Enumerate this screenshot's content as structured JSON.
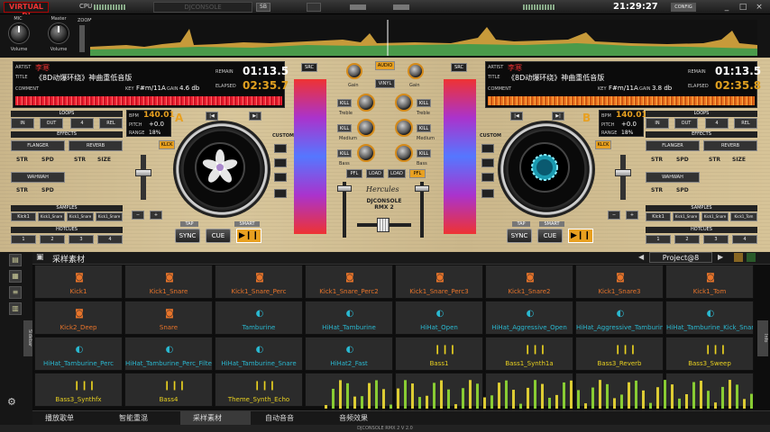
{
  "topbar": {
    "logo": "VIRTUAL DJ",
    "cpu_label": "CPU",
    "skin_name": "DJCONSOLE",
    "sb_label": "SB",
    "clock": "21:29:27",
    "config_label": "CONFIG",
    "minimize": "_",
    "maximize": "□",
    "close": "×"
  },
  "master": {
    "mic_label": "MIC",
    "master_label": "Master",
    "volume_label": "Volume",
    "zoom_label": "ZOOM"
  },
  "deck_a": {
    "artist_label": "ARTIST",
    "artist": "李寒",
    "title_label": "TITLE",
    "title": "《8D动爆环绕》神曲重低音版",
    "comment_label": "COMMENT",
    "key_label": "KEY",
    "key": "F#m/11A",
    "gain_label": "GAIN",
    "gain": "4.6 db",
    "remain_label": "REMAIN",
    "remain": "01:13.5",
    "elapsed_label": "ELAPSED",
    "elapsed": "02:35.7",
    "loops_label": "LOOPS",
    "loop_in": "IN",
    "loop_out": "OUT",
    "loop_size": "4",
    "loop_rel": "REL",
    "effects_label": "EFFECTS",
    "fx1": "FLANGER",
    "fx2": "REVERB",
    "fx3": "WAHWAH",
    "str": "STR",
    "spd": "SPD",
    "size": "SIZE",
    "bpm_label": "BPM",
    "bpm": "140.01",
    "pitch_label": "PITCH",
    "pitch": "+0.0",
    "range_label": "RANGE",
    "range": "18%",
    "deck_letter": "A",
    "klck": "KLCK",
    "custom": "CUSTOM",
    "samples_label": "SAMPLES",
    "samples": [
      "Kick1",
      "Kick1_Snare",
      "Kick1_Snare",
      "Kick1_Snare"
    ],
    "hotcues_label": "HOTCUES",
    "hotcues": [
      "1",
      "2",
      "3",
      "4"
    ],
    "tap": "TAP",
    "smart": "SMART",
    "sync": "SYNC",
    "cue": "CUE",
    "play": "▶❙❙",
    "src": "SRC",
    "minus": "−",
    "plus": "+"
  },
  "deck_b": {
    "artist_label": "ARTIST",
    "artist": "李寒",
    "title_label": "TITLE",
    "title": "《8D动爆环绕》神曲重低音版",
    "comment_label": "COMMENT",
    "key_label": "KEY",
    "key": "F#m/11A",
    "gain_label": "GAIN",
    "gain": "3.8 db",
    "remain_label": "REMAIN",
    "remain": "01:13.5",
    "elapsed_label": "ELAPSED",
    "elapsed": "02:35.8",
    "loops_label": "LOOPS",
    "loop_in": "IN",
    "loop_out": "OUT",
    "loop_size": "4",
    "loop_rel": "REL",
    "effects_label": "EFFECTS",
    "fx1": "FLANGER",
    "fx2": "REVERB",
    "fx3": "WAHWAH",
    "str": "STR",
    "spd": "SPD",
    "size": "SIZE",
    "bpm_label": "BPM",
    "bpm": "140.01",
    "pitch_label": "PITCH",
    "pitch": "+0.0",
    "range_label": "RANGE",
    "range": "18%",
    "deck_letter": "B",
    "klck": "KLCK",
    "custom": "CUSTOM",
    "samples_label": "SAMPLES",
    "samples": [
      "Kick1",
      "Kick1_Snare",
      "Kick1_Snare",
      "Kick1_Tom"
    ],
    "hotcues_label": "HOTCUES",
    "hotcues": [
      "1",
      "2",
      "3",
      "4"
    ],
    "tap": "TAP",
    "smart": "SMART",
    "sync": "SYNC",
    "cue": "CUE",
    "play": "▶❙❙",
    "src": "SRC",
    "minus": "−",
    "plus": "+"
  },
  "mixer": {
    "audio": "AUDIO",
    "vinyl": "VINYL",
    "gain": "Gain",
    "kill": "KILL",
    "treble": "Treble",
    "medium": "Medium",
    "bass": "Bass",
    "pfl": "PFL",
    "load": "LOAD",
    "brand": "Hercules",
    "model": "DJCONSOLE RMX 2"
  },
  "browser": {
    "folder_title": "采样素材",
    "project": "Project@8",
    "pads": [
      {
        "name": "Kick1",
        "icon": "drum",
        "color": "orange"
      },
      {
        "name": "Kick1_Snare",
        "icon": "drum",
        "color": "orange"
      },
      {
        "name": "Kick1_Snare_Perc",
        "icon": "drum",
        "color": "orange"
      },
      {
        "name": "Kick1_Snare_Perc2",
        "icon": "drum",
        "color": "orange"
      },
      {
        "name": "Kick1_Snare_Perc3",
        "icon": "drum",
        "color": "orange"
      },
      {
        "name": "Kick1_Snare2",
        "icon": "drum",
        "color": "orange"
      },
      {
        "name": "Kick1_Snare3",
        "icon": "drum",
        "color": "orange"
      },
      {
        "name": "Kick1_Tom",
        "icon": "drum",
        "color": "orange"
      },
      {
        "name": "Kick2_Deep",
        "icon": "drum",
        "color": "orange"
      },
      {
        "name": "Snare",
        "icon": "drum",
        "color": "orange"
      },
      {
        "name": "Tamburine",
        "icon": "cymbal",
        "color": "cyan"
      },
      {
        "name": "HiHat_Tamburine",
        "icon": "cymbal",
        "color": "cyan"
      },
      {
        "name": "HiHat_Open",
        "icon": "cymbal",
        "color": "cyan"
      },
      {
        "name": "HiHat_Aggressive_Open",
        "icon": "cymbal",
        "color": "cyan"
      },
      {
        "name": "HiHat_Aggressive_Tamburine_Open",
        "icon": "cymbal",
        "color": "cyan"
      },
      {
        "name": "HiHat_Tamburine_Kick_Snare",
        "icon": "cymbal",
        "color": "cyan"
      },
      {
        "name": "HiHat_Tamburine_Perc",
        "icon": "cymbal",
        "color": "cyan"
      },
      {
        "name": "HiHat_Tamburine_Perc_Filtered",
        "icon": "cymbal",
        "color": "cyan"
      },
      {
        "name": "HiHat_Tamburine_Snare",
        "icon": "cymbal",
        "color": "cyan"
      },
      {
        "name": "HiHat2_Fast",
        "icon": "cymbal",
        "color": "cyan"
      },
      {
        "name": "Bass1",
        "icon": "bars",
        "color": "yellow"
      },
      {
        "name": "Bass1_Synth1a",
        "icon": "bars",
        "color": "yellow"
      },
      {
        "name": "Bass3_Reverb",
        "icon": "bars",
        "color": "yellow"
      },
      {
        "name": "Bass3_Sweep",
        "icon": "bars",
        "color": "yellow"
      },
      {
        "name": "Bass3_Synthfx",
        "icon": "bars",
        "color": "yellow"
      },
      {
        "name": "Bass4",
        "icon": "bars",
        "color": "yellow"
      },
      {
        "name": "Theme_Synth_Echo",
        "icon": "bars",
        "color": "yellow"
      },
      {
        "name": "",
        "icon": "",
        "color": ""
      },
      {
        "name": "",
        "icon": "",
        "color": ""
      },
      {
        "name": "",
        "icon": "",
        "color": ""
      },
      {
        "name": "",
        "icon": "",
        "color": ""
      },
      {
        "name": "",
        "icon": "",
        "color": ""
      }
    ],
    "tabs": [
      "播放歌单",
      "智能重混",
      "采样素材",
      "自动音音",
      "音频效果",
      "",
      "",
      ""
    ],
    "sidebar_label": "Sidebar",
    "info_label": "Info",
    "footer": "DJCONSOLE RMX 2 V 2.0"
  }
}
